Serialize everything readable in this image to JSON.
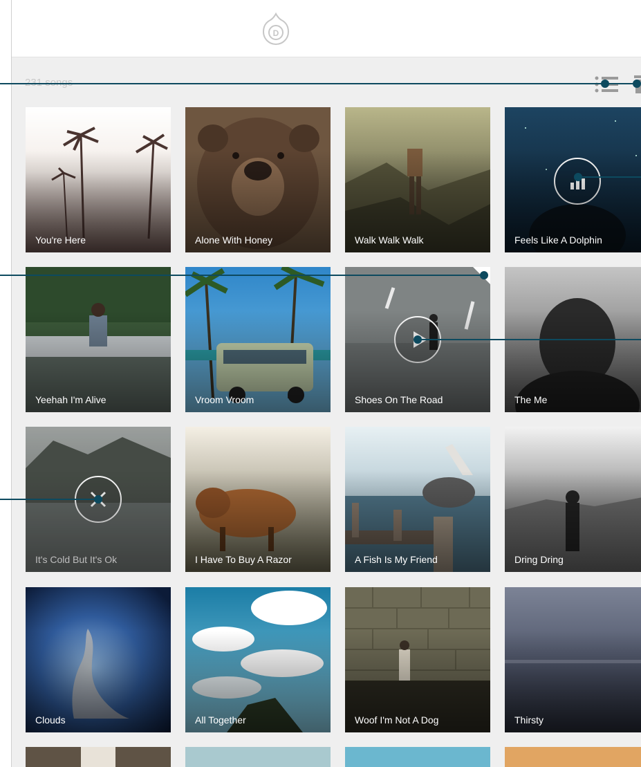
{
  "library": {
    "song_count": "231 songs"
  },
  "toolbar": {
    "list_icon": "list-view-icon",
    "trash_icon": "trash-icon"
  },
  "accent": "#0d4a5f",
  "tiles": [
    {
      "title": "You're Here"
    },
    {
      "title": "Alone With Honey"
    },
    {
      "title": "Walk Walk Walk"
    },
    {
      "title": "Feels Like A Dolphin"
    },
    {
      "title": "Yeehah I'm Alive"
    },
    {
      "title": "Vroom Vroom"
    },
    {
      "title": "Shoes On The Road"
    },
    {
      "title": "The Me"
    },
    {
      "title": "It's Cold But It's Ok"
    },
    {
      "title": "I Have To Buy A Razor"
    },
    {
      "title": "A Fish Is My Friend"
    },
    {
      "title": "Dring Dring"
    },
    {
      "title": "Clouds"
    },
    {
      "title": "All Together"
    },
    {
      "title": "Woof I'm Not A Dog"
    },
    {
      "title": "Thirsty"
    }
  ],
  "overlays": {
    "now_playing_icon": "equalizer-icon",
    "play_icon": "play-icon",
    "remove_icon": "close-icon"
  }
}
